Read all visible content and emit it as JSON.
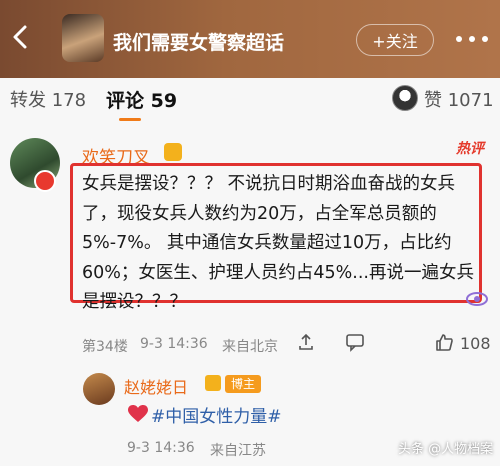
{
  "header": {
    "title": "我们需要女警察超话",
    "follow_label": "+关注"
  },
  "tabs": {
    "repost": "转发 178",
    "comments": "评论 59",
    "likes": "赞 1071"
  },
  "comment": {
    "username": "欢笑刀叉",
    "hot_label": "热评",
    "text": "女兵是摆设？？？ 不说抗日时期浴血奋战的女兵了，现役女兵人数约为20万，占全军总员额的5%-7%。 其中通信女兵数量超过10万，占比约60%；女医生、护理人员约占45%...再说一遍女兵是摆设？？？",
    "floor": "第34楼",
    "time": "9-3 14:36",
    "location": "来自北京",
    "like_count": "108"
  },
  "reply": {
    "username": "赵姥姥日",
    "tag": "博主",
    "text": "#中国女性力量#",
    "time": "9-3 14:36",
    "location": "来自江苏"
  },
  "watermark": "头条 @人物档案",
  "colors": {
    "accent": "#f07b19",
    "username": "#e96a1a",
    "highlight_border": "#e0322f",
    "topic_link": "#2f5fa8"
  },
  "icons": [
    "back-arrow-icon",
    "more-icon",
    "crown-icon",
    "comment-icon",
    "share-icon",
    "thumb-up-icon",
    "heart-icon"
  ]
}
